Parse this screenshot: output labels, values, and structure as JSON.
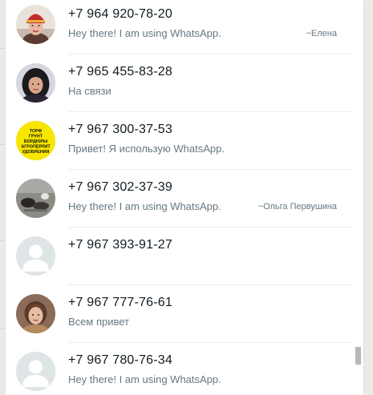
{
  "contacts": [
    {
      "phone": "+7 964 920-78-20",
      "status": "Hey there! I am using WhatsApp.",
      "pushname": "~Елена",
      "avatar": "red-hat-woman-photo"
    },
    {
      "phone": "+7 965 455-83-28",
      "status": "На связи",
      "pushname": "",
      "avatar": "dark-hair-woman-photo"
    },
    {
      "phone": "+7 967 300-37-53",
      "status": "Привет! Я использую WhatsApp.",
      "pushname": "",
      "avatar": "yellow-logo-photo",
      "avatar_text": [
        "ТОРФ",
        "ГРУНТ",
        "БОРДЮРЫ",
        "АГРОПЕРЛИТ",
        "УДОБРЕНИЯ"
      ]
    },
    {
      "phone": "+7 967 302-37-39",
      "status": "Hey there! I am using WhatsApp.",
      "pushname": "~Ольга Первушина",
      "avatar": "pets-on-ground-photo"
    },
    {
      "phone": "+7 967 393-91-27",
      "status": "",
      "pushname": "",
      "avatar": "default-person-icon"
    },
    {
      "phone": "+7 967 777-76-61",
      "status": "Всем привет",
      "pushname": "",
      "avatar": "woman-portrait-photo"
    },
    {
      "phone": "+7 967 780-76-34",
      "status": "Hey there! I am using WhatsApp.",
      "pushname": "",
      "avatar": "default-person-icon"
    }
  ],
  "colors": {
    "primary_text": "#111b21",
    "secondary_text": "#667781",
    "divider": "#e9edef",
    "logo_yellow": "#f7e600"
  }
}
